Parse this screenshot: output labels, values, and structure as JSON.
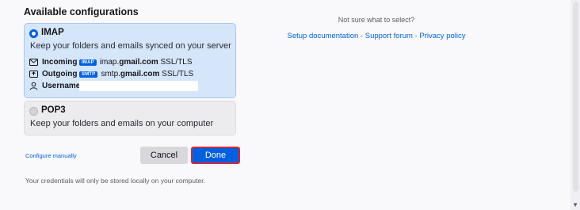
{
  "heading": "Available configurations",
  "imap": {
    "protocol": "IMAP",
    "description": "Keep your folders and emails synced on your server",
    "incoming_label": "Incoming",
    "incoming_tag": "IMAP",
    "incoming_host_prefix": "imap.",
    "incoming_host_bold": "gmail.com",
    "incoming_security": "SSL/TLS",
    "outgoing_label": "Outgoing",
    "outgoing_tag": "SMTP",
    "outgoing_host_prefix": "smtp.",
    "outgoing_host_bold": "gmail.com",
    "outgoing_security": "SSL/TLS",
    "username_label": "Username",
    "username_value": ""
  },
  "pop3": {
    "protocol": "POP3",
    "description": "Keep your folders and emails on your computer"
  },
  "configure_manually": "Configure manually",
  "cancel_label": "Cancel",
  "done_label": "Done",
  "footer": "Your credentials will only be stored locally on your computer.",
  "help": {
    "hint": "Not sure what to select?",
    "setup_docs": "Setup documentation",
    "separator": " - ",
    "support_forum": "Support forum",
    "privacy_policy": "Privacy policy"
  },
  "icons": {
    "incoming": "envelope-icon",
    "outgoing": "outbox-icon",
    "username": "user-icon",
    "scroll_down": "chevron-down-icon"
  },
  "colors": {
    "accent": "#0060df",
    "highlight_border": "#d72638",
    "selected_card": "#d6e6fa"
  }
}
